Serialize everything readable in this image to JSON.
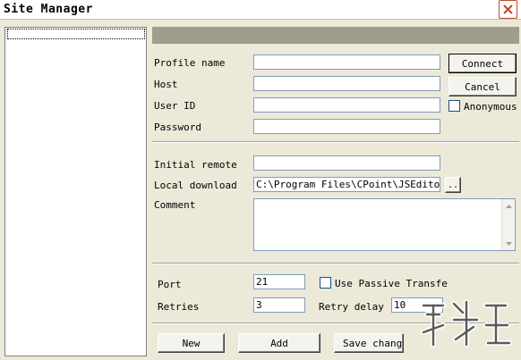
{
  "window": {
    "title": "Site Manager"
  },
  "form": {
    "profile_name_label": "Profile name",
    "host_label": "Host",
    "user_id_label": "User ID",
    "password_label": "Password",
    "initial_remote_label": "Initial remote",
    "local_download_label": "Local download",
    "local_download_value": "C:\\Program Files\\CPoint\\JSEditor\\F",
    "browse_label": "..",
    "comment_label": "Comment",
    "port_label": "Port",
    "port_value": "21",
    "use_passive_label": "Use Passive Transfe",
    "retries_label": "Retries",
    "retries_value": "3",
    "retry_delay_label": "Retry delay",
    "retry_delay_value": "10",
    "anonymous_label": "Anonymous"
  },
  "buttons": {
    "connect": "Connect",
    "cancel": "Cancel",
    "new": "New",
    "add": "Add",
    "save_changes": "Save chang"
  },
  "colors": {
    "dialog_bg": "#ece9d8",
    "header_strip": "#a09d8d",
    "field_border": "#7f9db9"
  }
}
